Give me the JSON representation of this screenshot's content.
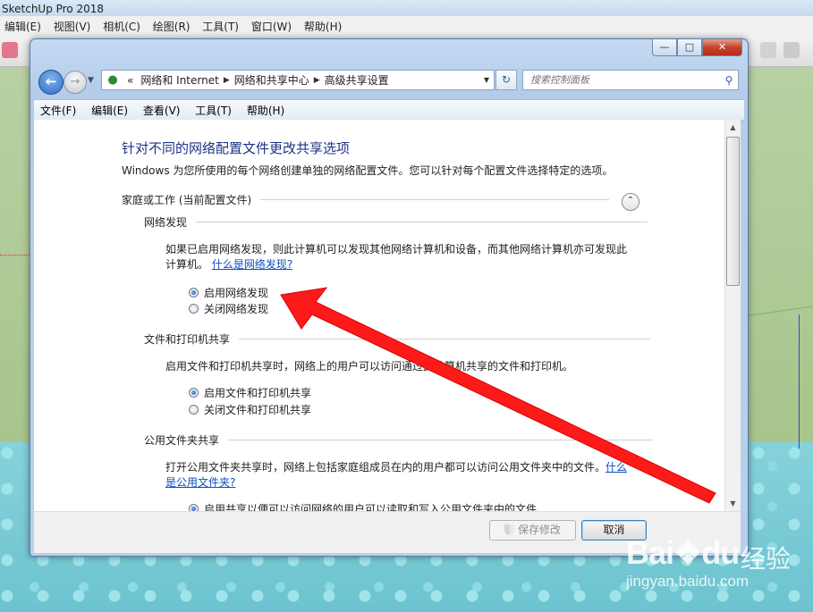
{
  "background_app": {
    "title": "SketchUp Pro 2018",
    "title_visible": "SketchUp Pro 2018",
    "menu": [
      "编辑(E)",
      "视图(V)",
      "相机(C)",
      "绘图(R)",
      "工具(T)",
      "窗口(W)",
      "帮助(H)"
    ]
  },
  "window": {
    "controls": {
      "minimize": "—",
      "maximize": "□",
      "close": "✕"
    }
  },
  "nav": {
    "breadcrumb": [
      "网络和 Internet",
      "网络和共享中心",
      "高级共享设置"
    ],
    "breadcrumb_prefix": "«",
    "search_placeholder": "搜索控制面板"
  },
  "menu": [
    "文件(F)",
    "编辑(E)",
    "查看(V)",
    "工具(T)",
    "帮助(H)"
  ],
  "content": {
    "title": "针对不同的网络配置文件更改共享选项",
    "description": "Windows 为您所使用的每个网络创建单独的网络配置文件。您可以针对每个配置文件选择特定的选项。",
    "profile": "家庭或工作 (当前配置文件)",
    "network_discovery": {
      "heading": "网络发现",
      "text_line1": "如果已启用网络发现，则此计算机可以发现其他网络计算机和设备，而其他网络计算机亦可发现此",
      "text_line2": "计算机。",
      "link": "什么是网络发现?",
      "options": [
        "启用网络发现",
        "关闭网络发现"
      ],
      "selected": 0
    },
    "file_printer_sharing": {
      "heading": "文件和打印机共享",
      "text": "启用文件和打印机共享时，网络上的用户可以访问通过此计算机共享的文件和打印机。",
      "options": [
        "启用文件和打印机共享",
        "关闭文件和打印机共享"
      ],
      "selected": 0
    },
    "public_folder_sharing": {
      "heading": "公用文件夹共享",
      "text": "打开公用文件夹共享时，网络上包括家庭组成员在内的用户都可以访问公用文件夹中的文件。",
      "link_part1": "什么",
      "link_part2": "是公用文件夹?",
      "option": "启用共享以便可以访问网络的用户可以读取和写入公用文件夹中的文件"
    }
  },
  "footer": {
    "save": "保存修改",
    "cancel": "取消"
  },
  "watermark": {
    "brand": "Bai",
    "brand_suffix": "du",
    "brand_cn": "经验",
    "url": "jingyan.baidu.com"
  },
  "colors": {
    "title_blue": "#1e3287",
    "link_blue": "#0a4fbf",
    "annotation_arrow": "#ff1a1a"
  }
}
